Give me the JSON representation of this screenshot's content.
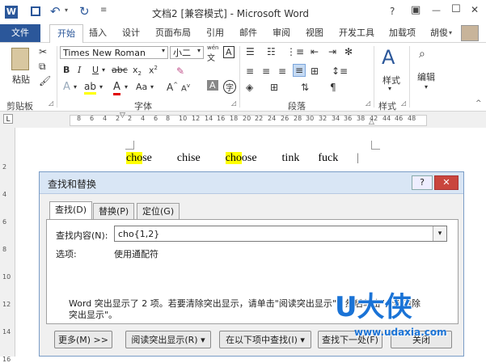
{
  "window": {
    "title": "文档2 [兼容模式] - Microsoft Word",
    "help": "?",
    "restore_ribbon": "▣",
    "minimize": "—",
    "maximize": "☐",
    "close": "✕"
  },
  "ribbon_tabs": [
    "文件",
    "开始",
    "插入",
    "设计",
    "页面布局",
    "引用",
    "邮件",
    "审阅",
    "视图",
    "开发工具",
    "加载项"
  ],
  "user": "胡俊",
  "font": {
    "name": "Times New Roman",
    "size": "小二",
    "wen": "wén",
    "wen_char": "文"
  },
  "groups": {
    "clipboard": "剪贴板",
    "font": "字体",
    "paragraph": "段落",
    "styles": "样式",
    "editing_label": "编辑"
  },
  "clipboard": {
    "paste": "粘贴"
  },
  "styles": {
    "label": "样式"
  },
  "ruler_ticks": [
    "8",
    "6",
    "4",
    "2",
    "2",
    "4",
    "6",
    "8",
    "10",
    "12",
    "14",
    "16",
    "18",
    "20",
    "22",
    "24",
    "26",
    "28",
    "30",
    "32",
    "34",
    "36",
    "38",
    "42",
    "44",
    "46",
    "48"
  ],
  "vruler_ticks": [
    "2",
    "4",
    "6",
    "8",
    "10",
    "12",
    "14",
    "16"
  ],
  "document": {
    "words": [
      "chose",
      "chise",
      "choose",
      "tink",
      "fuck"
    ],
    "hl_prefix_1": "cho",
    "rest_1": "se",
    "hl_prefix_3": "cho",
    "rest_3": "ose"
  },
  "dialog": {
    "title": "查找和替换",
    "help": "?",
    "close": "✕",
    "tabs": [
      "查找(D)",
      "替换(P)",
      "定位(G)"
    ],
    "find_label": "查找内容(N):",
    "find_value": "cho{1,2}",
    "options_label": "选项:",
    "options_value": "使用通配符",
    "message": "Word 突出显示了 2 项。若要清除突出显示，请单击\"阅读突出显示\"，然后单击\"全部清除突出显示\"。",
    "buttons": {
      "more": "更多(M) >>",
      "reading_highlight": "阅读突出显示(R) ▾",
      "find_in": "在以下项中查找(I) ▾",
      "find_next": "查找下一处(F)",
      "cancel": "关闭"
    }
  },
  "watermark": {
    "logo": "U大侠",
    "url": "www.udaxia.com"
  },
  "colors": {
    "accent": "#2b579a",
    "highlight": "#ffff00",
    "watermark": "#1a73d6"
  }
}
